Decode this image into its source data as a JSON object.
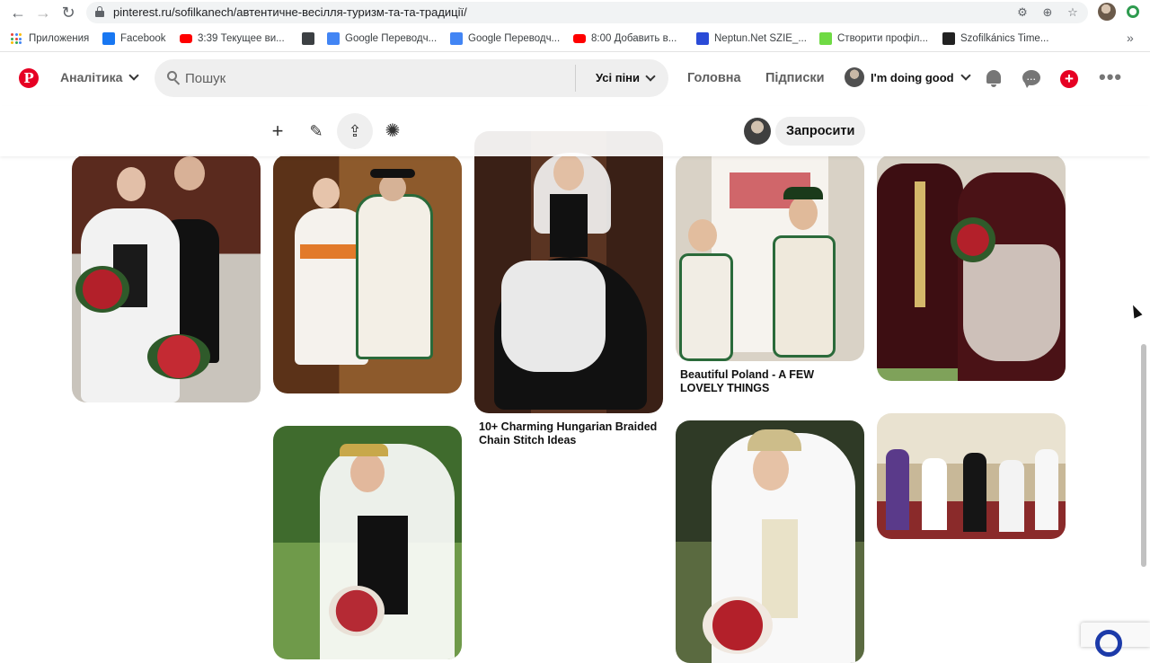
{
  "browser": {
    "url": "pinterest.ru/sofilkanech/автентичне-весілля-туризм-та-та-традиції/",
    "bookmarks": [
      {
        "label": "Приложения",
        "icon": "apps-grid-icon"
      },
      {
        "label": "Facebook",
        "icon": "facebook-icon",
        "color": "#1877f2"
      },
      {
        "label": "3:39 Текущее ви...",
        "icon": "youtube-icon",
        "color": "#ff0000"
      },
      {
        "label": "",
        "icon": "globe-icon"
      },
      {
        "label": "Google Переводч...",
        "icon": "google-translate-icon",
        "color": "#4285f4"
      },
      {
        "label": "Google Переводч...",
        "icon": "google-translate-icon",
        "color": "#4285f4"
      },
      {
        "label": "8:00 Добавить в...",
        "icon": "youtube-icon",
        "color": "#ff0000"
      },
      {
        "label": "Neptun.Net SZIE_...",
        "icon": "neptun-icon",
        "color": "#2a4bd7"
      },
      {
        "label": "Створити профіл...",
        "icon": "upwork-icon",
        "color": "#6fda44"
      },
      {
        "label": "Szofilkánics Time...",
        "icon": "toggl-icon",
        "color": "#222222"
      }
    ]
  },
  "header": {
    "logo": "P",
    "analytics_label": "Аналітика",
    "search_placeholder": "Пошук",
    "filter_label": "Усі піни",
    "home_label": "Головна",
    "following_label": "Підписки",
    "user_name": "I'm doing good",
    "brand_color": "#e60023"
  },
  "board_toolbar": {
    "invite_label": "Запросити"
  },
  "pins": [
    {
      "name": "pin-wedding-couple-black-vests",
      "caption": ""
    },
    {
      "name": "pin-polish-highland-wedding",
      "caption": ""
    },
    {
      "name": "pin-hungarian-lace-dress",
      "caption": "10+ Charming Hungarian Braided Chain Stitch Ideas"
    },
    {
      "name": "pin-polish-children-costume",
      "caption": "Beautiful Poland - A FEW LOVELY THINGS"
    },
    {
      "name": "pin-hungarian-couple-velvet",
      "caption": ""
    },
    {
      "name": "pin-bride-black-bodice",
      "caption": ""
    },
    {
      "name": "pin-bride-crown-veil",
      "caption": ""
    },
    {
      "name": "pin-church-wedding-procession",
      "caption": ""
    }
  ]
}
